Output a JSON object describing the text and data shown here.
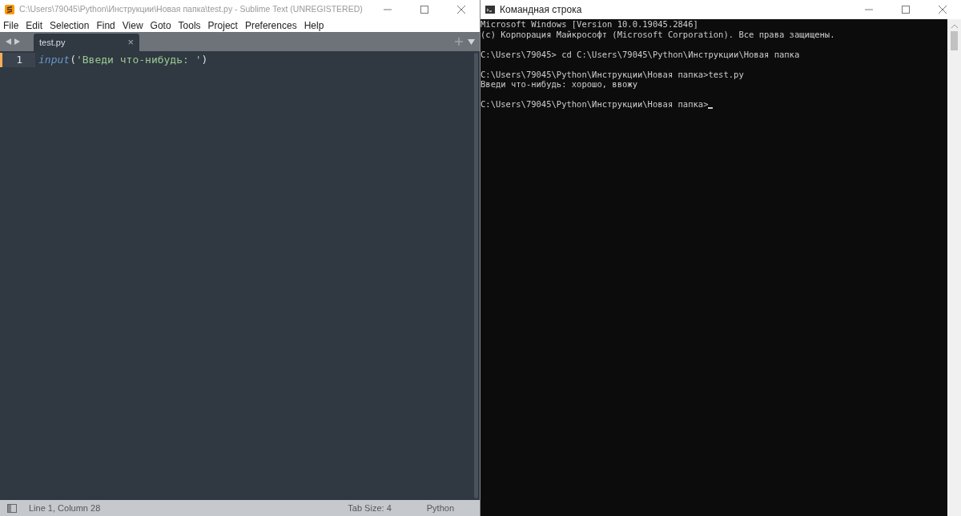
{
  "editor": {
    "window": {
      "title": "C:\\Users\\79045\\Python\\Инструкции\\Новая папка\\test.py - Sublime Text (UNREGISTERED)"
    },
    "menu": [
      "File",
      "Edit",
      "Selection",
      "Find",
      "View",
      "Goto",
      "Tools",
      "Project",
      "Preferences",
      "Help"
    ],
    "tabs": [
      {
        "label": "test.py",
        "close": "×",
        "selected": true
      }
    ],
    "lines": [
      {
        "number": "1",
        "current": true,
        "tokens": [
          {
            "kind": "function",
            "text": "input"
          },
          {
            "kind": "punct",
            "text": "("
          },
          {
            "kind": "string",
            "text": "'Введи что-нибудь: '"
          },
          {
            "kind": "punct",
            "text": ")"
          }
        ]
      }
    ],
    "status_bar": {
      "position": "Line 1, Column 28",
      "tab_size": "Tab Size: 4",
      "syntax": "Python"
    }
  },
  "console": {
    "window": {
      "title": "Командная строка"
    },
    "blocks": [
      [
        "Microsoft Windows [Version 10.0.19045.2846]",
        "(c) Корпорация Майкрософт (Microsoft Corporation). Все права защищены."
      ],
      [
        "C:\\Users\\79045> cd C:\\Users\\79045\\Python\\Инструкции\\Новая папка"
      ],
      [
        "C:\\Users\\79045\\Python\\Инструкции\\Новая папка>test.py",
        "Введи что-нибудь: хорошо, ввожу"
      ],
      [
        "C:\\Users\\79045\\Python\\Инструкции\\Новая папка>"
      ]
    ],
    "cursor": true
  }
}
